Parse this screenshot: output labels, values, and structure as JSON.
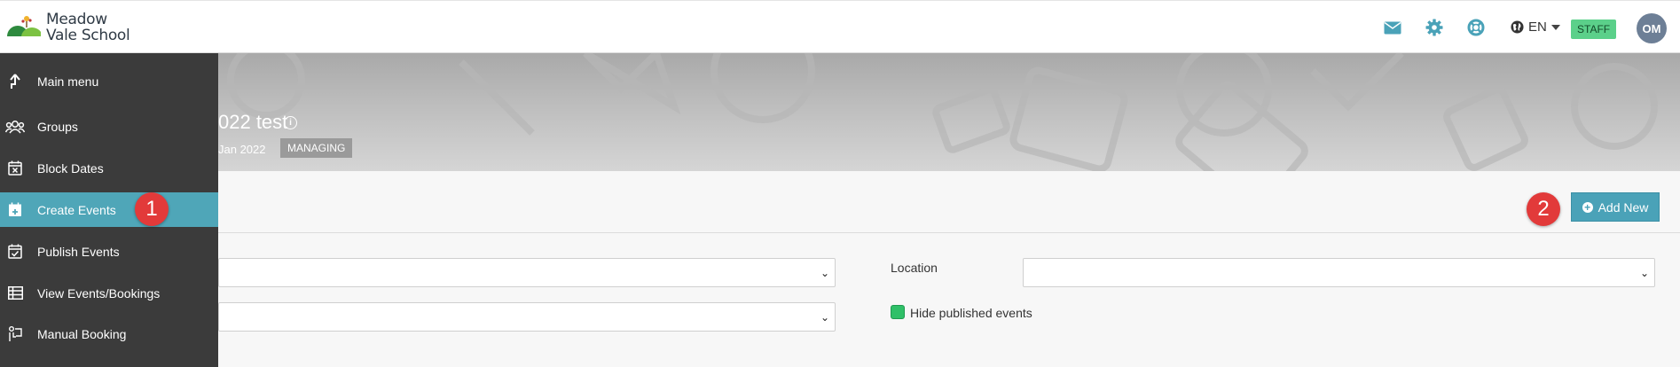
{
  "brand": {
    "line1": "Meadow",
    "line2": "Vale School"
  },
  "header_icons": [
    "mail-icon",
    "gear-icon",
    "help-lifebuoy-icon"
  ],
  "language": {
    "code": "EN"
  },
  "staff_badge": "STAFF",
  "user_initials": "OM",
  "banner": {
    "title_partial": "022 test",
    "date_partial": "Jan 2022",
    "status": "MANAGING"
  },
  "sidebar": {
    "items": [
      {
        "label": "Main menu",
        "icon": "arrow-up-icon"
      },
      {
        "label": "Groups",
        "icon": "users-icon"
      },
      {
        "label": "Block Dates",
        "icon": "calendar-x-icon"
      },
      {
        "label": "Create Events",
        "icon": "calendar-plus-icon"
      },
      {
        "label": "Publish Events",
        "icon": "calendar-check-icon"
      },
      {
        "label": "View Events/Bookings",
        "icon": "table-icon"
      },
      {
        "label": "Manual Booking",
        "icon": "manual-booking-icon"
      }
    ]
  },
  "actions": {
    "add_new": "Add New"
  },
  "filters": {
    "location_label": "Location",
    "hide_published_label": "Hide published events",
    "hide_published_checked": true
  },
  "annotations": {
    "step1": "1",
    "step2": "2"
  },
  "colors": {
    "accent": "#4fa6b8",
    "staff": "#5bd08a",
    "annotation": "#e23a3a",
    "sidebar": "#3b3b3b"
  }
}
